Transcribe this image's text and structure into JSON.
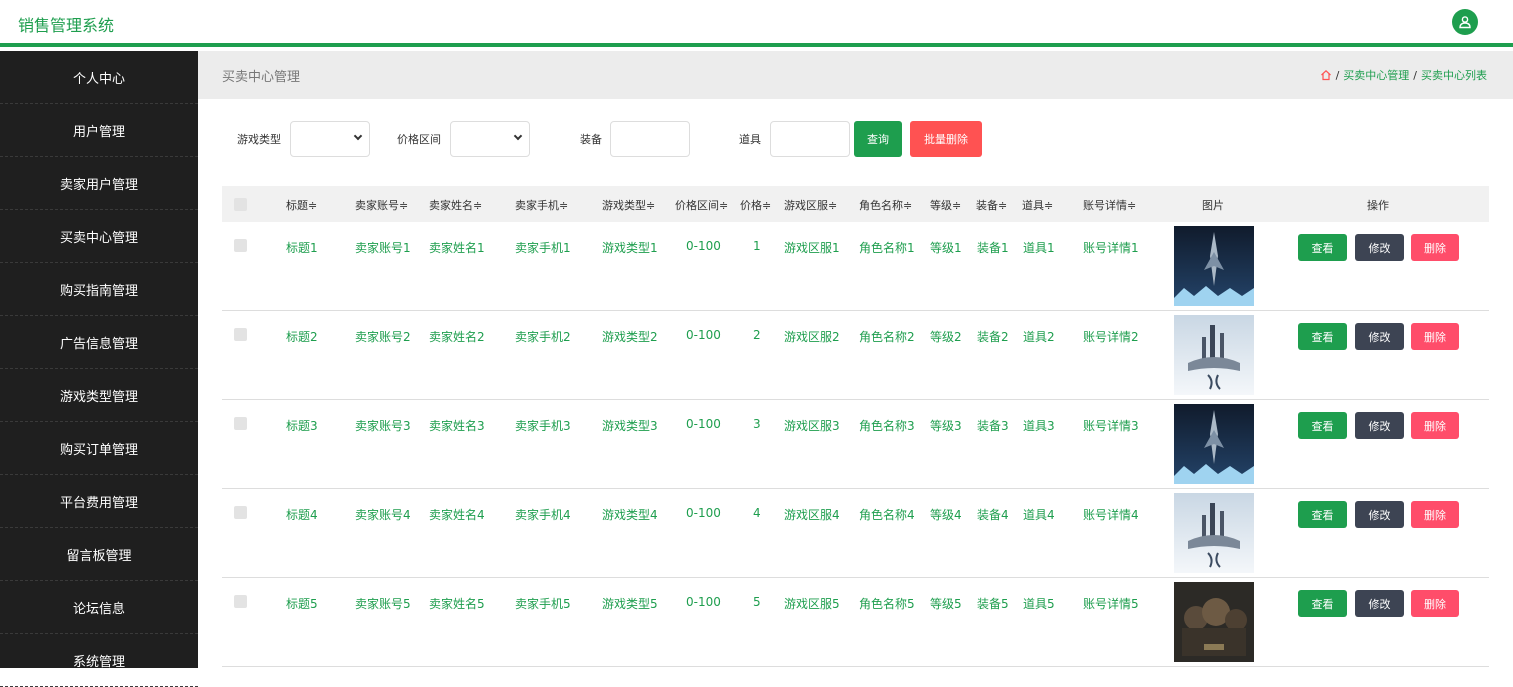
{
  "app": {
    "title": "销售管理系统"
  },
  "sidebar": {
    "items": [
      {
        "label": "个人中心"
      },
      {
        "label": "用户管理"
      },
      {
        "label": "卖家用户管理"
      },
      {
        "label": "买卖中心管理"
      },
      {
        "label": "购买指南管理"
      },
      {
        "label": "广告信息管理"
      },
      {
        "label": "游戏类型管理"
      },
      {
        "label": "购买订单管理"
      },
      {
        "label": "平台费用管理"
      },
      {
        "label": "留言板管理"
      },
      {
        "label": "论坛信息"
      },
      {
        "label": "系统管理"
      }
    ]
  },
  "header": {
    "page_title": "买卖中心管理",
    "breadcrumb": [
      "买卖中心管理",
      "买卖中心列表"
    ],
    "breadcrumb_sep": "/"
  },
  "filters": {
    "game_type_label": "游戏类型",
    "price_range_label": "价格区间",
    "equipment_label": "装备",
    "prop_label": "道具",
    "search_button": "查询",
    "batch_delete_button": "批量删除"
  },
  "table": {
    "columns": [
      "标题",
      "卖家账号",
      "卖家姓名",
      "卖家手机",
      "游戏类型",
      "价格区间",
      "价格",
      "游戏区服",
      "角色名称",
      "等级",
      "装备",
      "道具",
      "账号详情",
      "图片",
      "操作"
    ],
    "sort_mark": "≑",
    "rows": [
      {
        "title": "标题1",
        "seller_account": "卖家账号1",
        "seller_name": "卖家姓名1",
        "seller_phone": "卖家手机1",
        "game_type": "游戏类型1",
        "price_range": "0-100",
        "price": "1",
        "server": "游戏区服1",
        "role_name": "角色名称1",
        "level": "等级1",
        "equipment": "装备1",
        "prop": "道具1",
        "account_detail": "账号详情1",
        "image": "dark"
      },
      {
        "title": "标题2",
        "seller_account": "卖家账号2",
        "seller_name": "卖家姓名2",
        "seller_phone": "卖家手机2",
        "game_type": "游戏类型2",
        "price_range": "0-100",
        "price": "2",
        "server": "游戏区服2",
        "role_name": "角色名称2",
        "level": "等级2",
        "equipment": "装备2",
        "prop": "道具2",
        "account_detail": "账号详情2",
        "image": "light"
      },
      {
        "title": "标题3",
        "seller_account": "卖家账号3",
        "seller_name": "卖家姓名3",
        "seller_phone": "卖家手机3",
        "game_type": "游戏类型3",
        "price_range": "0-100",
        "price": "3",
        "server": "游戏区服3",
        "role_name": "角色名称3",
        "level": "等级3",
        "equipment": "装备3",
        "prop": "道具3",
        "account_detail": "账号详情3",
        "image": "dark"
      },
      {
        "title": "标题4",
        "seller_account": "卖家账号4",
        "seller_name": "卖家姓名4",
        "seller_phone": "卖家手机4",
        "game_type": "游戏类型4",
        "price_range": "0-100",
        "price": "4",
        "server": "游戏区服4",
        "role_name": "角色名称4",
        "level": "等级4",
        "equipment": "装备4",
        "prop": "道具4",
        "account_detail": "账号详情4",
        "image": "light"
      },
      {
        "title": "标题5",
        "seller_account": "卖家账号5",
        "seller_name": "卖家姓名5",
        "seller_phone": "卖家手机5",
        "game_type": "游戏类型5",
        "price_range": "0-100",
        "price": "5",
        "server": "游戏区服5",
        "role_name": "角色名称5",
        "level": "等级5",
        "equipment": "装备5",
        "prop": "道具5",
        "account_detail": "账号详情5",
        "image": "war"
      }
    ],
    "actions": {
      "view": "查看",
      "edit": "修改",
      "delete": "删除"
    }
  },
  "colors": {
    "accent": "#1e9e4e",
    "danger": "#ff5252",
    "sidebar_bg": "#1f1f1f",
    "edit_btn": "#3d4453"
  }
}
